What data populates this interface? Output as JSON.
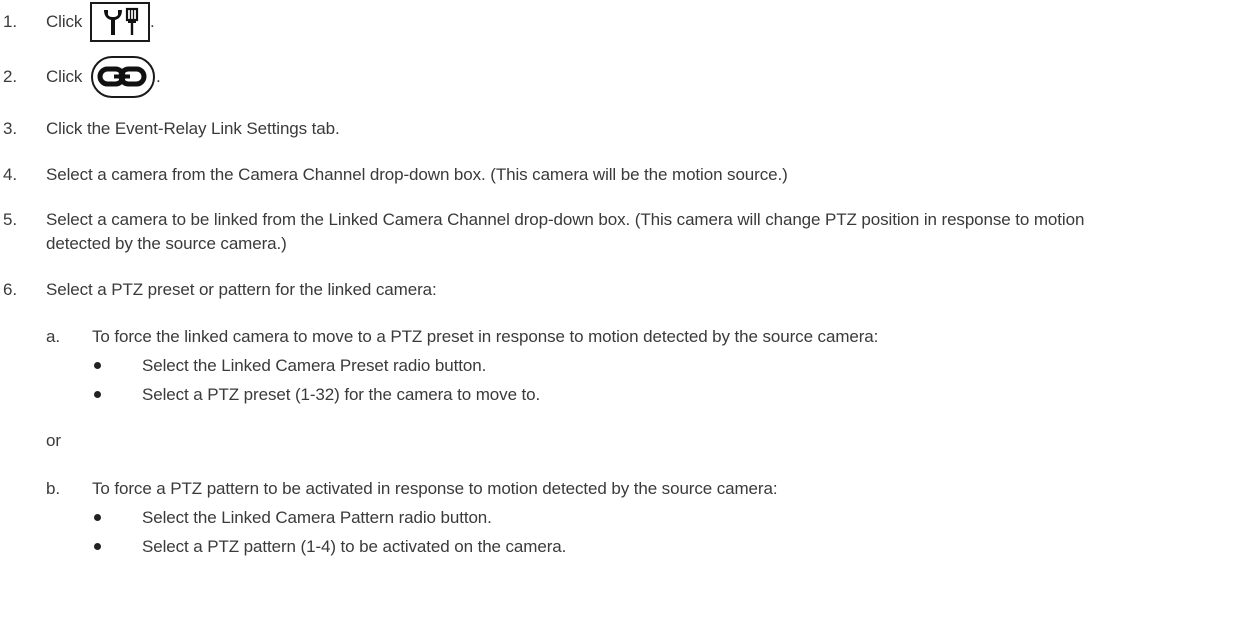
{
  "steps": {
    "s1": {
      "num": "1.",
      "text": "Click",
      "after": "."
    },
    "s2": {
      "num": "2.",
      "text": "Click",
      "after": "."
    },
    "s3": {
      "num": "3.",
      "text": "Click the Event-Relay Link Settings tab."
    },
    "s4": {
      "num": "4.",
      "text": "Select a camera from the Camera Channel drop-down box. (This camera will be the motion source.)"
    },
    "s5": {
      "num": "5.",
      "line1": "Select a camera to be linked from the Linked Camera Channel drop-down box. (This camera will change PTZ position in response to motion",
      "line2": "detected by the source camera.)"
    },
    "s6": {
      "num": "6.",
      "text": "Select a PTZ preset or pattern for the linked camera:"
    }
  },
  "substeps": {
    "a": {
      "letter": "a.",
      "text": "To force the linked camera to move to a PTZ preset in response to motion detected by the source camera:",
      "bullets": [
        "Select the Linked Camera Preset radio button.",
        "Select a PTZ preset (1-32) for the camera to move to."
      ]
    },
    "or": "or",
    "b": {
      "letter": "b.",
      "text": "To force a PTZ pattern to be activated in response to motion detected by the source camera:",
      "bullets": [
        "Select the Linked Camera Pattern radio button.",
        "Select a PTZ pattern (1-4) to be activated on the camera."
      ]
    }
  },
  "icons": {
    "step1": "tools-icon",
    "step2": "link-icon"
  }
}
